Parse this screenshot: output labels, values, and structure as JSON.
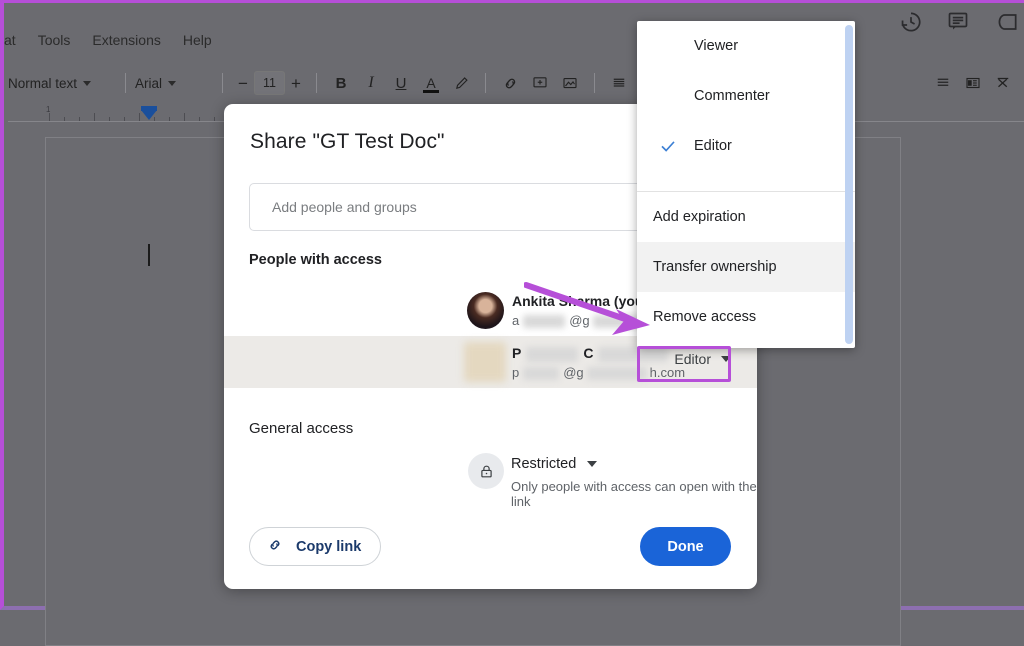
{
  "accent": {
    "annotation_purple": "#b64fd8",
    "primary_blue": "#1a64d8",
    "check_blue": "#3b7fd4"
  },
  "docs_app": {
    "menubar": [
      {
        "label": "at",
        "name": "menu-format-partial"
      },
      {
        "label": "Tools",
        "name": "menu-tools"
      },
      {
        "label": "Extensions",
        "name": "menu-extensions"
      },
      {
        "label": "Help",
        "name": "menu-help"
      }
    ],
    "toolbar": {
      "paragraph_style": "Normal text",
      "font": "Arial",
      "font_size": "11",
      "decrease_label": "−",
      "increase_label": "+",
      "bold_label": "B",
      "italic_label": "I",
      "underline_label": "U",
      "text_color_label": "A"
    },
    "ruler": {
      "first_number": "1"
    }
  },
  "share_dialog": {
    "title": "Share \"GT Test Doc\"",
    "add_people_placeholder": "Add people and groups",
    "people_section_heading": "People with access",
    "people": [
      {
        "name": "Ankita Sharma (you)",
        "email_prefix": "a",
        "email_mid": "@g",
        "email_suffix": "h.com",
        "role": "",
        "avatar": "user-photo-avatar",
        "hovered": false
      },
      {
        "name_initial_1": "P",
        "name_initial_2": "C",
        "email_prefix": "p",
        "email_mid": "@g",
        "email_suffix": "h.com",
        "role": "Editor",
        "avatar": "blurred-avatar",
        "hovered": true
      }
    ],
    "general_section_heading": "General access",
    "general_access": {
      "value": "Restricted",
      "description": "Only people with access can open with the link",
      "icon": "lock-icon"
    },
    "copy_link_label": "Copy link",
    "done_label": "Done"
  },
  "role_menu": {
    "roles": [
      {
        "label": "Viewer",
        "checked": false
      },
      {
        "label": "Commenter",
        "checked": false
      },
      {
        "label": "Editor",
        "checked": true
      }
    ],
    "actions": [
      {
        "label": "Add expiration",
        "highlighted": false
      },
      {
        "label": "Transfer ownership",
        "highlighted": true
      },
      {
        "label": "Remove access",
        "highlighted": false
      }
    ]
  }
}
